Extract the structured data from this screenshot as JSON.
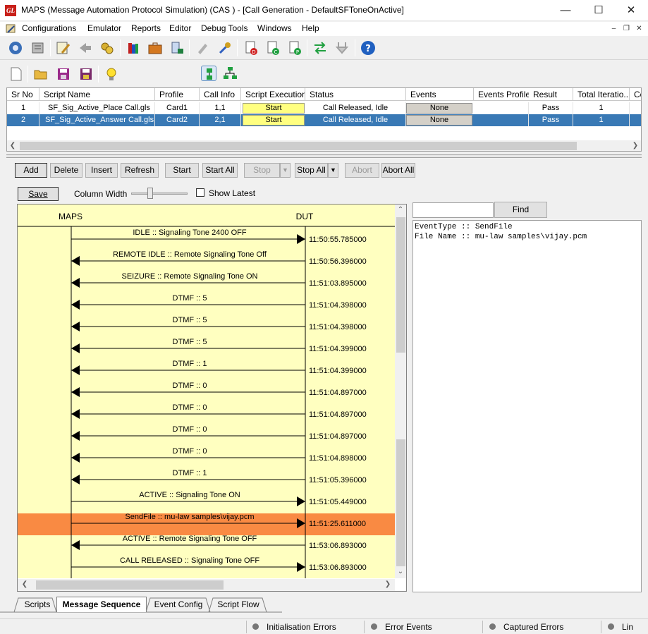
{
  "window": {
    "title": "MAPS (Message Automation Protocol Simulation)  (CAS ) - [Call Generation  - DefaultSFToneOnActive]",
    "logo_text": "GL"
  },
  "menu": {
    "items": [
      "Configurations",
      "Emulator",
      "Reports",
      "Editor",
      "Debug Tools",
      "Windows",
      "Help"
    ]
  },
  "grid": {
    "headers": [
      "Sr No",
      "Script Name",
      "Profile",
      "Call Info",
      "Script Execution",
      "Status",
      "Events",
      "Events Profile",
      "Result",
      "Total Iteratio...",
      "Co"
    ],
    "rows": [
      {
        "sr": "1",
        "script": "SF_Sig_Active_Place Call.gls",
        "profile": "Card1",
        "callinfo": "1,1",
        "exec": "Start",
        "status": "Call Released, Idle",
        "events": "None",
        "events_profile": "",
        "result": "Pass",
        "total": "1"
      },
      {
        "sr": "2",
        "script": "SF_Sig_Active_Answer Call.gls",
        "profile": "Card2",
        "callinfo": "2,1",
        "exec": "Start",
        "status": "Call Released, Idle",
        "events": "None",
        "events_profile": "",
        "result": "Pass",
        "total": "1"
      }
    ],
    "selected_row": 1,
    "colors": {
      "selected_bg": "#3979b5",
      "exec_button": "#ffff80"
    }
  },
  "controls": {
    "add": "Add",
    "delete": "Delete",
    "insert": "Insert",
    "refresh": "Refresh",
    "start": "Start",
    "start_all": "Start All",
    "stop": "Stop",
    "stop_all": "Stop All",
    "abort": "Abort",
    "abort_all": "Abort All"
  },
  "sequence_toolbar": {
    "save": "Save",
    "column_width": "Column Width",
    "show_latest": "Show Latest",
    "show_latest_checked": false
  },
  "sequence": {
    "left_entity": "MAPS",
    "right_entity": "DUT",
    "background": "#ffffc0",
    "highlight_color": "#f98a43",
    "highlighted_index": 13,
    "messages": [
      {
        "label": "IDLE :: Signaling Tone 2400 OFF",
        "dir": "right",
        "time": "11:50:55.785000"
      },
      {
        "label": "REMOTE IDLE :: Remote Signaling Tone Off",
        "dir": "left",
        "time": "11:50:56.396000"
      },
      {
        "label": "SEIZURE :: Remote Signaling Tone ON",
        "dir": "left",
        "time": "11:51:03.895000"
      },
      {
        "label": "DTMF :: 5",
        "dir": "left",
        "time": "11:51:04.398000"
      },
      {
        "label": "DTMF :: 5",
        "dir": "left",
        "time": "11:51:04.398000"
      },
      {
        "label": "DTMF :: 5",
        "dir": "left",
        "time": "11:51:04.399000"
      },
      {
        "label": "DTMF :: 1",
        "dir": "left",
        "time": "11:51:04.399000"
      },
      {
        "label": "DTMF :: 0",
        "dir": "left",
        "time": "11:51:04.897000"
      },
      {
        "label": "DTMF :: 0",
        "dir": "left",
        "time": "11:51:04.897000"
      },
      {
        "label": "DTMF :: 0",
        "dir": "left",
        "time": "11:51:04.897000"
      },
      {
        "label": "DTMF :: 0",
        "dir": "left",
        "time": "11:51:04.898000"
      },
      {
        "label": "DTMF :: 1",
        "dir": "left",
        "time": "11:51:05.396000"
      },
      {
        "label": "ACTIVE :: Signaling Tone ON",
        "dir": "right",
        "time": "11:51:05.449000"
      },
      {
        "label": "SendFile  :: mu-law samples\\vijay.pcm",
        "dir": "right",
        "time": "11:51:25.611000"
      },
      {
        "label": "ACTIVE :: Remote Signaling Tone OFF",
        "dir": "left",
        "time": "11:53:06.893000"
      },
      {
        "label": "CALL RELEASED :: Signaling Tone OFF",
        "dir": "right",
        "time": "11:53:06.893000"
      }
    ]
  },
  "find": {
    "button": "Find",
    "value": ""
  },
  "event_details": {
    "lines": [
      "EventType :: SendFile",
      "File Name :: mu-law samples\\vijay.pcm"
    ]
  },
  "tabs": {
    "items": [
      "Scripts",
      "Message Sequence",
      "Event Config",
      "Script Flow"
    ],
    "active": 1
  },
  "statusbar": {
    "items": [
      "Initialisation Errors",
      "Error Events",
      "Captured Errors",
      "Lin"
    ]
  }
}
